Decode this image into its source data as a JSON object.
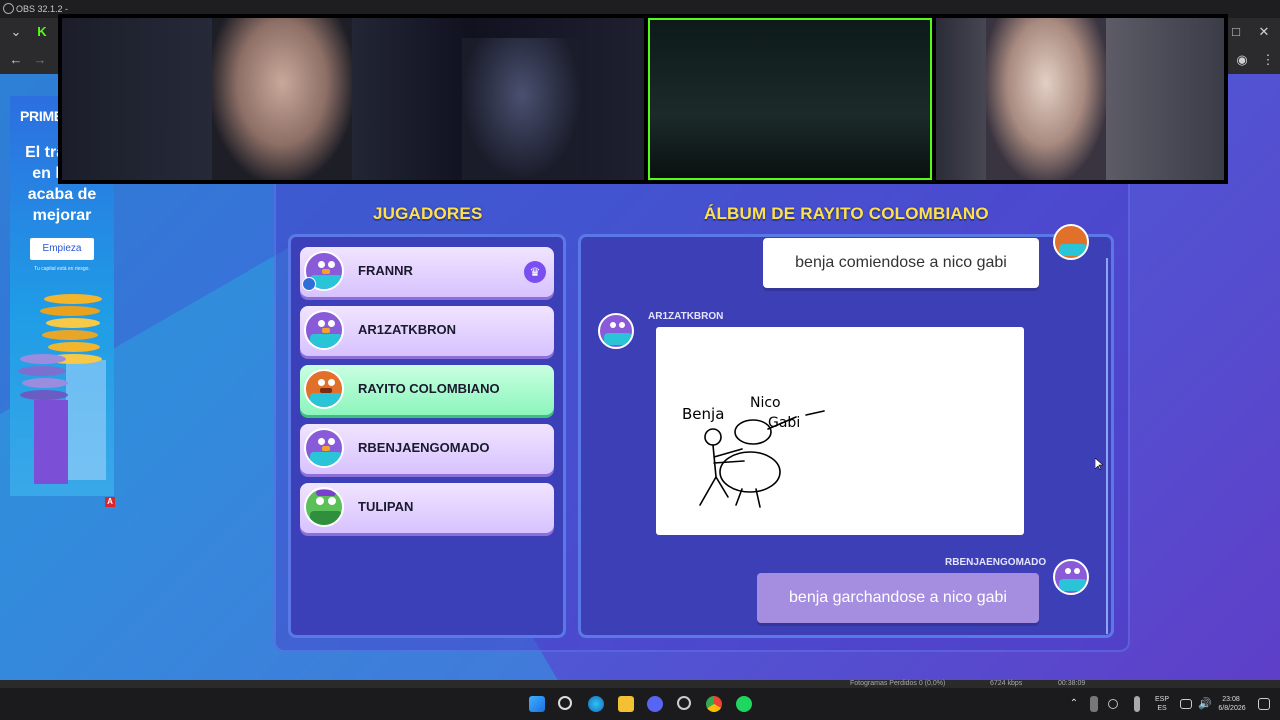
{
  "obs": {
    "title": "OBS 32.1.2 -"
  },
  "ad": {
    "brand": "PRIME XBT",
    "headline": "El trading en línea acaba de mejorar",
    "cta": "Empieza",
    "risk_note": "Tu capital está en riesgo.",
    "badge": "A"
  },
  "game": {
    "players_title": "JUGADORES",
    "album_title": "ÁLBUM DE RAYITO COLOMBIANO",
    "players": [
      {
        "name": "FRANNR",
        "host": true
      },
      {
        "name": "AR1ZATKBRON"
      },
      {
        "name": "RAYITO COLOMBIANO",
        "active": true
      },
      {
        "name": "RBENJAENGOMADO"
      },
      {
        "name": "TULIPAN"
      }
    ],
    "album": {
      "entry1_text": "benja comiendose a nico gabi",
      "entry2_author": "AR1ZATKBRON",
      "drawing_labels": [
        "Benja",
        "Nico",
        "Gabi"
      ],
      "entry3_author": "RBENJAENGOMADO",
      "entry3_text": "benja garchandose a nico gabi"
    }
  },
  "status": {
    "dropped": "Fotogramas Perdidos 0 (0,0%)",
    "bitrate": "6724 kbps",
    "time": "00:38:09"
  },
  "taskbar": {
    "lang": "ESP",
    "region": "ES",
    "clock": "23:08",
    "date": "6/8/2026"
  }
}
